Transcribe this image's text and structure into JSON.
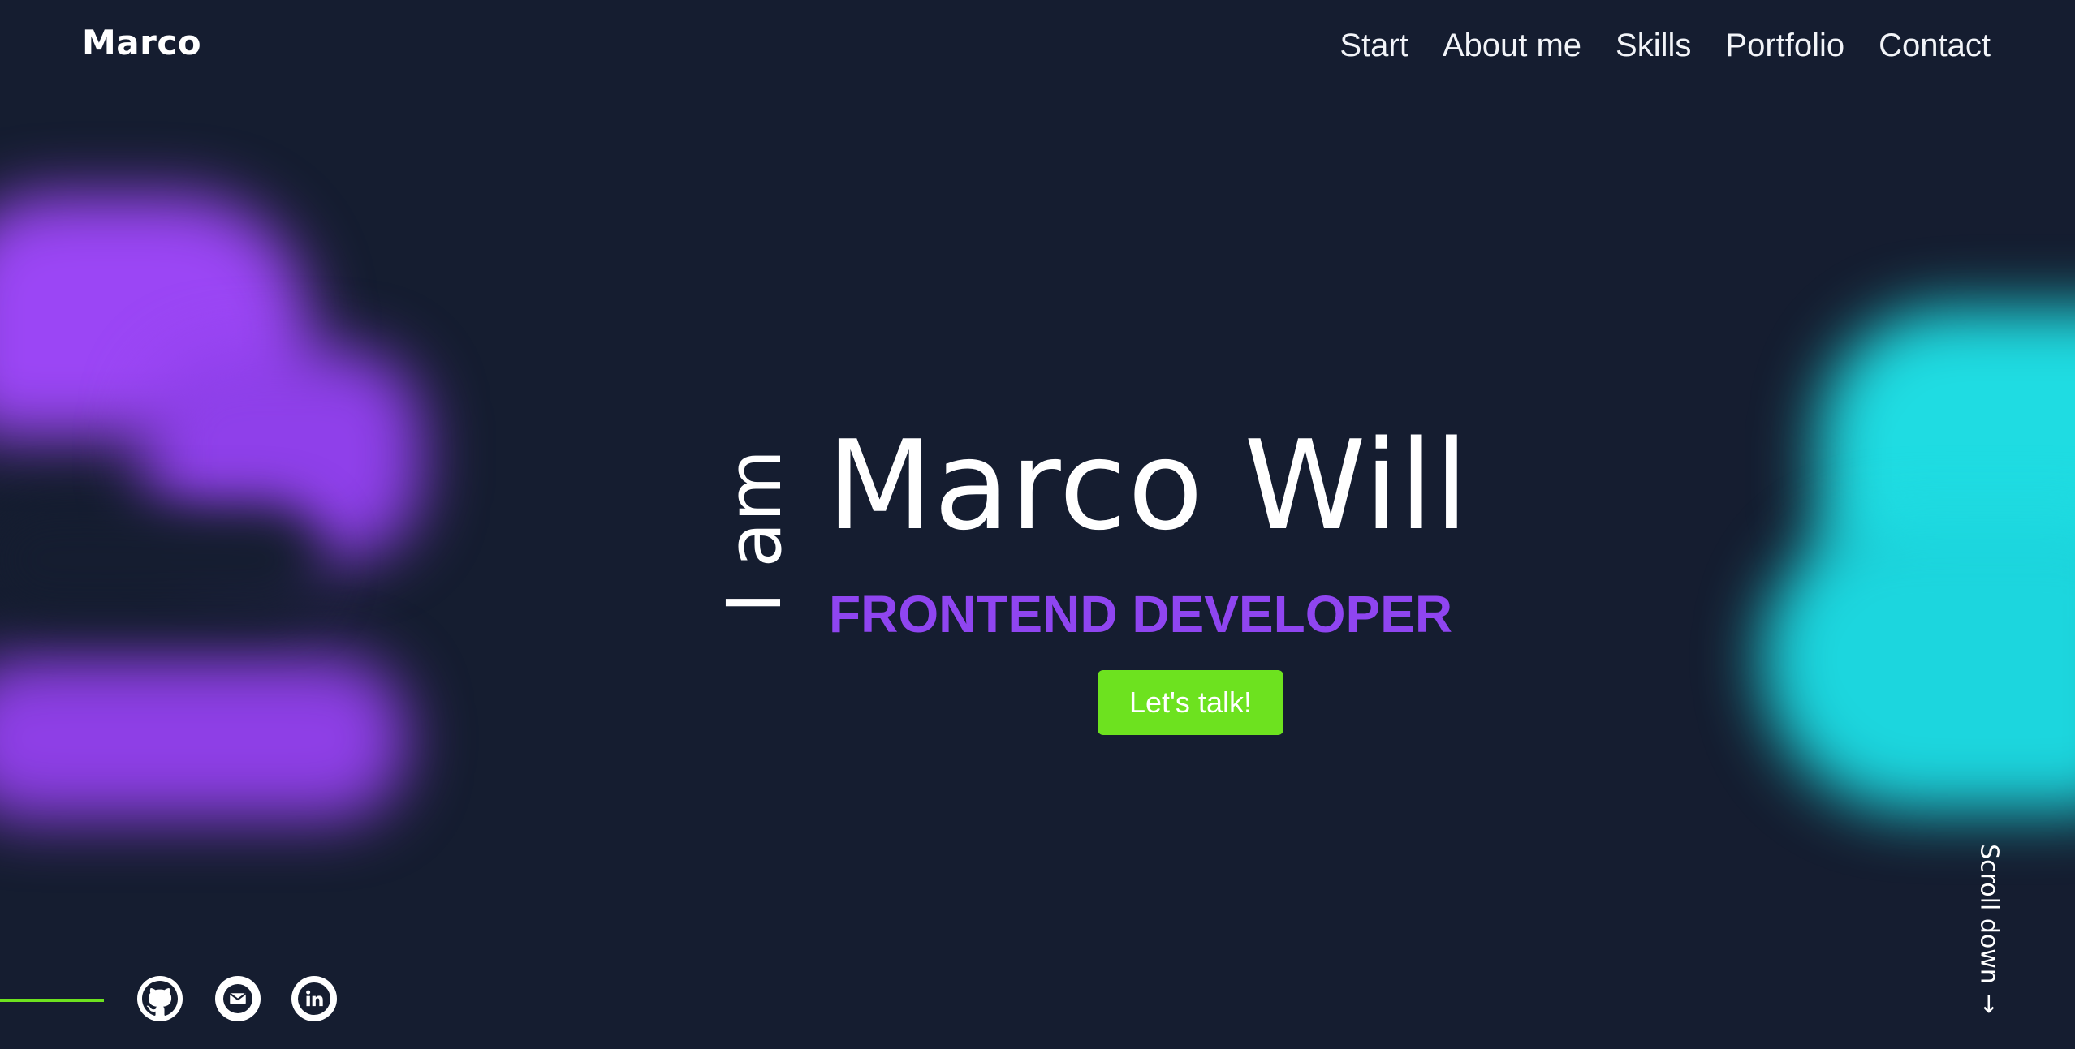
{
  "header": {
    "logo": "Marco",
    "nav": [
      "Start",
      "About me",
      "Skills",
      "Portfolio",
      "Contact"
    ]
  },
  "hero": {
    "prefix": "I am",
    "name": "Marco Will",
    "role": "FRONTEND DEVELOPER",
    "cta_label": "Let's talk!"
  },
  "scroll": {
    "label": "Scroll down",
    "icon": "arrow-right-icon"
  },
  "social": {
    "icons": [
      "github-icon",
      "mail-icon",
      "linkedin-icon"
    ]
  },
  "colors": {
    "background": "#151d30",
    "accent_green": "#6de21f",
    "accent_purple": "#8f45f0",
    "accent_cyan": "#1fdce2"
  }
}
